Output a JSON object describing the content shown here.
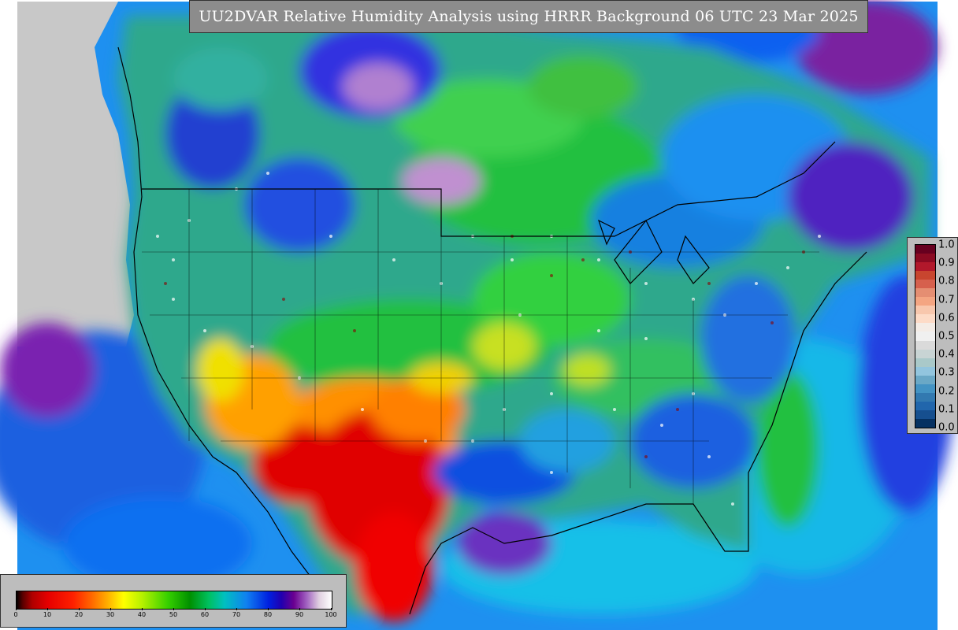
{
  "title": "UU2DVAR Relative Humidity Analysis using HRRR Background 06 UTC 23 Mar 2025",
  "humidity_colorbar": {
    "ticks": [
      "0",
      "10",
      "20",
      "30",
      "40",
      "50",
      "60",
      "70",
      "80",
      "90",
      "100"
    ]
  },
  "increment_colorbar": {
    "ticks": [
      "1.0",
      "0.9",
      "0.8",
      "0.7",
      "0.6",
      "0.5",
      "0.4",
      "0.3",
      "0.2",
      "0.1",
      "0.0"
    ],
    "colors": [
      "#67001f",
      "#8b0a22",
      "#b2182b",
      "#c8452f",
      "#d6604d",
      "#e58e72",
      "#f4a582",
      "#f8c7ad",
      "#fddbc7",
      "#f4ece6",
      "#f0f0f0",
      "#dadada",
      "#c8d4d4",
      "#a9c9c9",
      "#92c5de",
      "#6aa8c6",
      "#4393c3",
      "#3279b0",
      "#2166ac",
      "#164f8f",
      "#053061"
    ]
  },
  "colors": {
    "land_background": "#2ea88c",
    "ocean_background": "#1e90f0",
    "outside_domain": "#c8c8c8",
    "panel_gray": "#bdbdbd",
    "title_gray": "#8c8c8c"
  }
}
